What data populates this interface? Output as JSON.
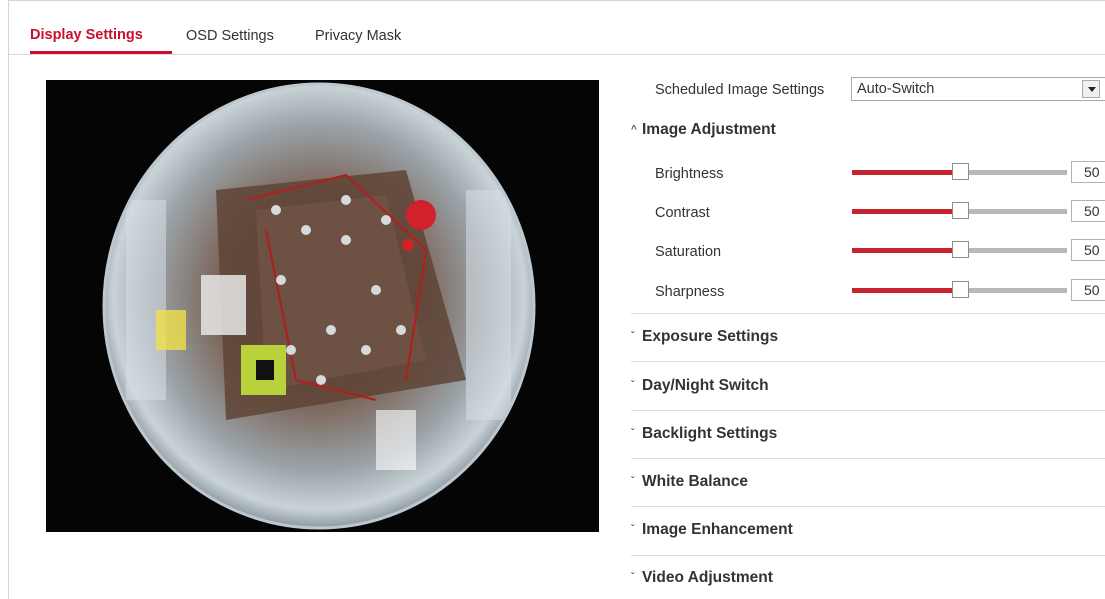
{
  "tabs": [
    {
      "label": "Display Settings",
      "active": true
    },
    {
      "label": "OSD Settings",
      "active": false
    },
    {
      "label": "Privacy Mask",
      "active": false
    }
  ],
  "scheduled": {
    "label": "Scheduled Image Settings",
    "value": "Auto-Switch"
  },
  "image_adjustment": {
    "title": "Image Adjustment",
    "expanded": true,
    "sliders": [
      {
        "label": "Brightness",
        "value": "50",
        "max": 100
      },
      {
        "label": "Contrast",
        "value": "50",
        "max": 100
      },
      {
        "label": "Saturation",
        "value": "50",
        "max": 100
      },
      {
        "label": "Sharpness",
        "value": "50",
        "max": 100
      }
    ]
  },
  "sections": [
    {
      "title": "Exposure Settings"
    },
    {
      "title": "Day/Night Switch"
    },
    {
      "title": "Backlight Settings"
    },
    {
      "title": "White Balance"
    },
    {
      "title": "Image Enhancement"
    },
    {
      "title": "Video Adjustment"
    }
  ],
  "colors": {
    "accent": "#c8102e",
    "slider_fill": "#c8242f",
    "slider_track": "#b8b8b8"
  },
  "icons": {
    "expanded": "chevron-up-icon",
    "collapsed": "chevron-down-icon"
  }
}
